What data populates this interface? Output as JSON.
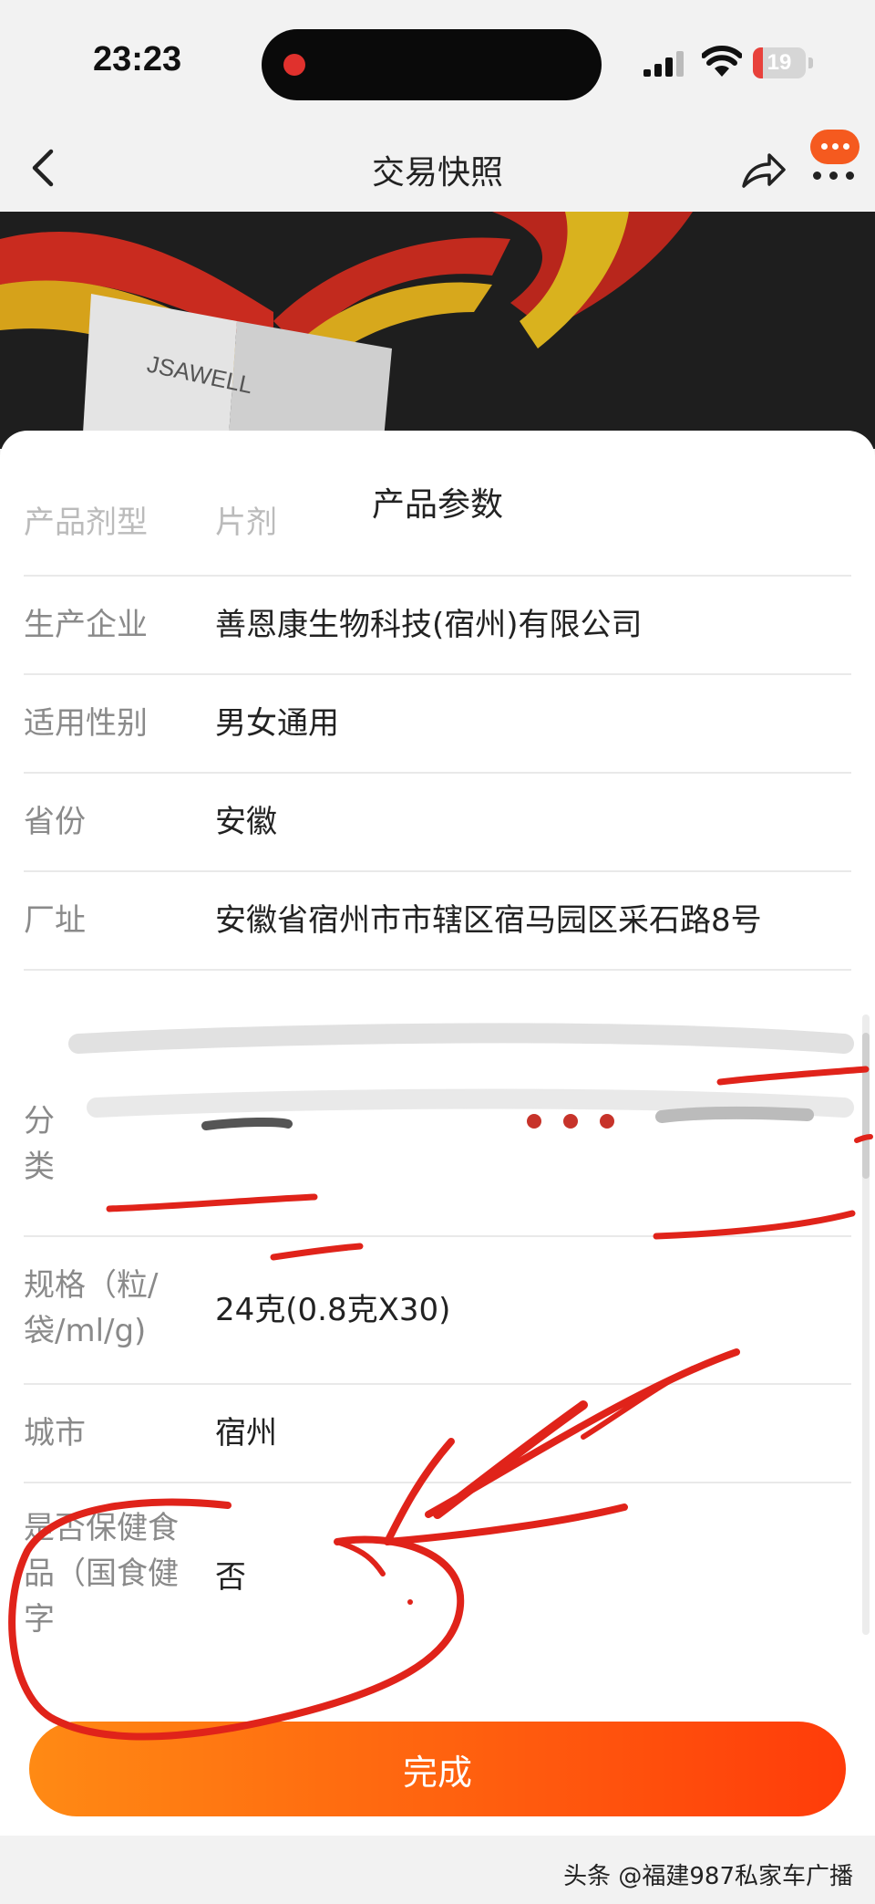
{
  "status_bar": {
    "time": "23:23",
    "battery_level": "19",
    "battery_fraction": 0.19
  },
  "nav": {
    "title": "交易快照"
  },
  "hero": {
    "box_brand": "JSAWELL"
  },
  "sheet": {
    "title": "产品参数",
    "rows": [
      {
        "key": "partial-top",
        "label": "产品剂型",
        "value": "片剂"
      },
      {
        "key": "manufacturer",
        "label": "生产企业",
        "value": "善恩康生物科技(宿州)有限公司"
      },
      {
        "key": "gender",
        "label": "适用性别",
        "value": "男女通用"
      },
      {
        "key": "province",
        "label": "省份",
        "value": "安徽"
      },
      {
        "key": "factory-address",
        "label": "厂址",
        "value": "安徽省宿州市市辖区宿马园区采石路8号"
      },
      {
        "key": "category",
        "label": "分类",
        "value": ""
      },
      {
        "key": "spec",
        "label": "规格（粒/袋/ml/g)",
        "value": "24克(0.8克X30)"
      },
      {
        "key": "city",
        "label": "城市",
        "value": "宿州"
      },
      {
        "key": "health-food",
        "label": "是否保健食品（国食健字",
        "value": "否"
      }
    ],
    "done_label": "完成"
  },
  "watermark": "头条 @福建987私家车广播",
  "colors": {
    "accent": "#ff5a14",
    "annotation": "#e0231a"
  }
}
